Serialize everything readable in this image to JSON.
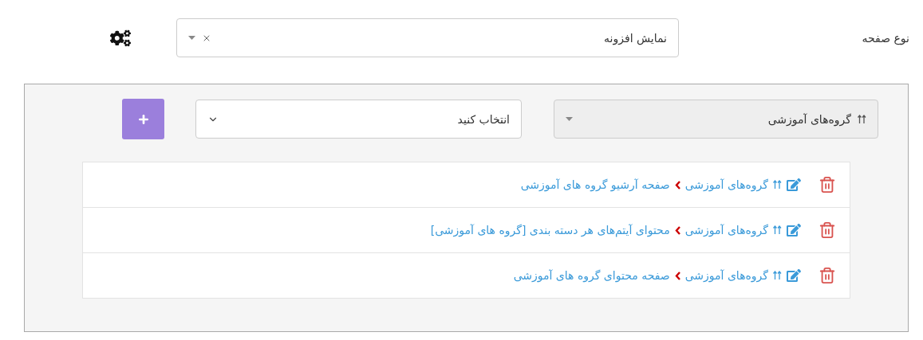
{
  "page_type": {
    "label": "نوع صفحه",
    "value": "نمایش افزونه"
  },
  "panel": {
    "category_select": {
      "value": "گروه‌های آموزشی"
    },
    "item_select": {
      "value": "انتخاب کنید"
    },
    "items": [
      {
        "category": "گروه‌های آموزشی",
        "title": "صفحه آرشیو گروه های آموزشی"
      },
      {
        "category": "گروه‌های آموزشی",
        "title": "محتوای آیتم‌های هر دسته بندی [گروه های آموزشی]"
      },
      {
        "category": "گروه‌های آموزشی",
        "title": "صفحه محتوای گروه های آموزشی"
      }
    ]
  }
}
